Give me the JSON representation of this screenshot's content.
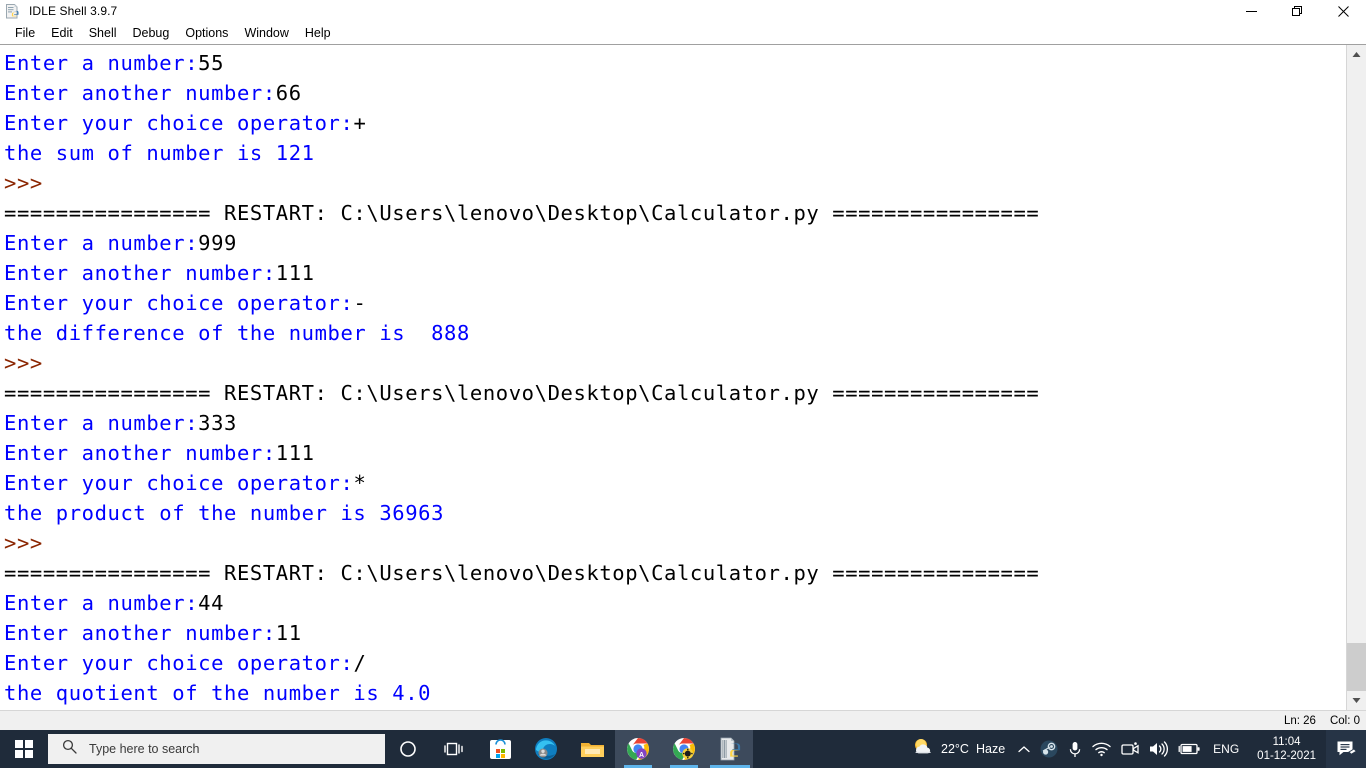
{
  "window": {
    "title": "IDLE Shell 3.9.7",
    "icon": "python-document-icon",
    "controls": {
      "minimize_label": "—",
      "maximize_label": "❐",
      "close_label": "✕"
    }
  },
  "menu": {
    "items": [
      {
        "label": "File"
      },
      {
        "label": "Edit"
      },
      {
        "label": "Shell"
      },
      {
        "label": "Debug"
      },
      {
        "label": "Options"
      },
      {
        "label": "Window"
      },
      {
        "label": "Help"
      }
    ]
  },
  "console": {
    "lines": [
      {
        "segments": [
          {
            "text": "Enter a number:",
            "color": "blue"
          },
          {
            "text": "55",
            "color": "black"
          }
        ]
      },
      {
        "segments": [
          {
            "text": "Enter another number:",
            "color": "blue"
          },
          {
            "text": "66",
            "color": "black"
          }
        ]
      },
      {
        "segments": [
          {
            "text": "Enter your choice operator:",
            "color": "blue"
          },
          {
            "text": "+",
            "color": "black"
          }
        ]
      },
      {
        "segments": [
          {
            "text": "the sum of number is 121",
            "color": "blue"
          }
        ]
      },
      {
        "segments": [
          {
            "text": ">>>",
            "color": "prompt"
          }
        ]
      },
      {
        "segments": [
          {
            "text": "================ RESTART: C:\\Users\\lenovo\\Desktop\\Calculator.py ================",
            "color": "black"
          }
        ]
      },
      {
        "segments": [
          {
            "text": "Enter a number:",
            "color": "blue"
          },
          {
            "text": "999",
            "color": "black"
          }
        ]
      },
      {
        "segments": [
          {
            "text": "Enter another number:",
            "color": "blue"
          },
          {
            "text": "111",
            "color": "black"
          }
        ]
      },
      {
        "segments": [
          {
            "text": "Enter your choice operator:",
            "color": "blue"
          },
          {
            "text": "-",
            "color": "black"
          }
        ]
      },
      {
        "segments": [
          {
            "text": "the difference of the number is  888",
            "color": "blue"
          }
        ]
      },
      {
        "segments": [
          {
            "text": ">>>",
            "color": "prompt"
          }
        ]
      },
      {
        "segments": [
          {
            "text": "================ RESTART: C:\\Users\\lenovo\\Desktop\\Calculator.py ================",
            "color": "black"
          }
        ]
      },
      {
        "segments": [
          {
            "text": "Enter a number:",
            "color": "blue"
          },
          {
            "text": "333",
            "color": "black"
          }
        ]
      },
      {
        "segments": [
          {
            "text": "Enter another number:",
            "color": "blue"
          },
          {
            "text": "111",
            "color": "black"
          }
        ]
      },
      {
        "segments": [
          {
            "text": "Enter your choice operator:",
            "color": "blue"
          },
          {
            "text": "*",
            "color": "black"
          }
        ]
      },
      {
        "segments": [
          {
            "text": "the product of the number is 36963",
            "color": "blue"
          }
        ]
      },
      {
        "segments": [
          {
            "text": ">>>",
            "color": "prompt"
          }
        ]
      },
      {
        "segments": [
          {
            "text": "================ RESTART: C:\\Users\\lenovo\\Desktop\\Calculator.py ================",
            "color": "black"
          }
        ]
      },
      {
        "segments": [
          {
            "text": "Enter a number:",
            "color": "blue"
          },
          {
            "text": "44",
            "color": "black"
          }
        ]
      },
      {
        "segments": [
          {
            "text": "Enter another number:",
            "color": "blue"
          },
          {
            "text": "11",
            "color": "black"
          }
        ]
      },
      {
        "segments": [
          {
            "text": "Enter your choice operator:",
            "color": "blue"
          },
          {
            "text": "/",
            "color": "black"
          }
        ]
      },
      {
        "segments": [
          {
            "text": "the quotient of the number is 4.0",
            "color": "blue"
          }
        ]
      }
    ]
  },
  "status_bar": {
    "line_label": "Ln: 26",
    "col_label": "Col: 0"
  },
  "taskbar": {
    "start_icon": "windows-logo-icon",
    "search": {
      "placeholder": "Type here to search",
      "icon": "search-icon"
    },
    "pinned": [
      {
        "name": "cortana-icon",
        "active": false,
        "badge": null
      },
      {
        "name": "task-view-icon",
        "active": false,
        "badge": null
      },
      {
        "name": "microsoft-store-icon",
        "active": false,
        "badge": null
      },
      {
        "name": "microsoft-edge-icon",
        "active": false,
        "badge": null
      },
      {
        "name": "file-explorer-icon",
        "active": false,
        "badge": null
      },
      {
        "name": "google-chrome-icon",
        "active": true,
        "badge": "A"
      },
      {
        "name": "google-chrome-icon",
        "active": true,
        "badge": "gear"
      },
      {
        "name": "python-idle-icon",
        "active": true,
        "badge": null
      }
    ],
    "tray": {
      "weather": {
        "temperature": "22°C",
        "condition": "Haze",
        "icon": "sun-cloud-icon"
      },
      "overflow_icon": "chevron-up-icon",
      "icons": [
        {
          "name": "steam-icon"
        },
        {
          "name": "microphone-icon"
        },
        {
          "name": "wifi-icon"
        },
        {
          "name": "camera-icon"
        },
        {
          "name": "volume-icon"
        },
        {
          "name": "battery-icon"
        }
      ],
      "language": "ENG",
      "clock": {
        "time": "11:04",
        "date": "01-12-2021"
      },
      "action_center_icon": "notifications-icon"
    }
  },
  "colors": {
    "prompt": "#8b2500",
    "output": "#0000ff",
    "input": "#000000",
    "taskbar": "#1f2b3a",
    "accent": "#5fb4ea"
  }
}
